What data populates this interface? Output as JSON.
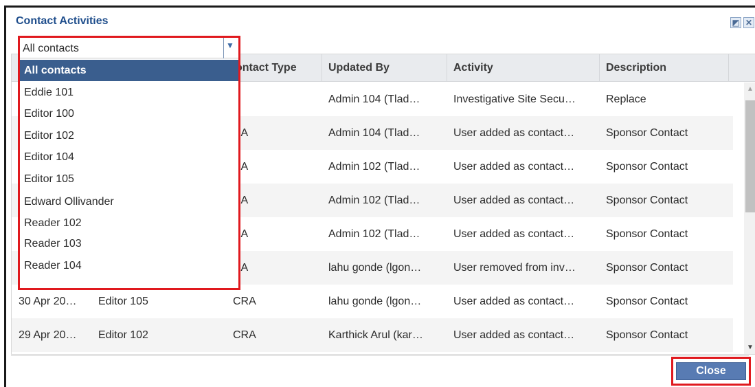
{
  "dialog": {
    "title": "Contact Activities",
    "maximize_icon": "maximize-icon",
    "close_icon": "close-icon"
  },
  "filter": {
    "selected": "All contacts",
    "options": [
      "All contacts",
      "Eddie 101",
      "Editor 100",
      "Editor 102",
      "Editor 104",
      "Editor 105",
      "Edward Ollivander",
      "Reader 102",
      "Reader 103",
      "Reader 104"
    ]
  },
  "table": {
    "headers": [
      "ontact Type",
      "Updated By",
      "Activity",
      "Description"
    ],
    "rows": [
      [
        "",
        "",
        "",
        "Admin 104 (Tlad…",
        "Investigative Site Secu…",
        "Replace"
      ],
      [
        "",
        "",
        "RA",
        "Admin 104 (Tlad…",
        "User added as contact…",
        "Sponsor Contact"
      ],
      [
        "",
        "",
        "RA",
        "Admin 102 (Tlad…",
        "User added as contact…",
        "Sponsor Contact"
      ],
      [
        "",
        "",
        "RA",
        "Admin 102 (Tlad…",
        "User added as contact…",
        "Sponsor Contact"
      ],
      [
        "",
        "",
        "RA",
        "Admin 102 (Tlad…",
        "User added as contact…",
        "Sponsor Contact"
      ],
      [
        "",
        "",
        "RA",
        "lahu gonde (lgon…",
        "User removed from inv…",
        "Sponsor Contact"
      ],
      [
        "30 Apr 20…",
        "Editor 105",
        "CRA",
        "lahu gonde (lgon…",
        "User added as contact…",
        "Sponsor Contact"
      ],
      [
        "29 Apr 20…",
        "Editor 102",
        "CRA",
        "Karthick Arul (kar…",
        "User added as contact…",
        "Sponsor Contact"
      ]
    ]
  },
  "footer": {
    "close_label": "Close"
  },
  "colors": {
    "title": "#1f4e8c",
    "highlight": "#e0191e",
    "selected_option": "#3a5e8e",
    "button": "#587bb3"
  }
}
